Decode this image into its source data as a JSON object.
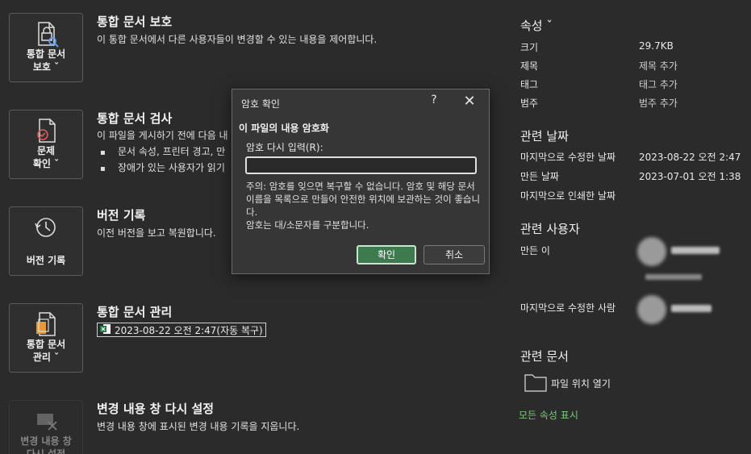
{
  "tiles": [
    {
      "label": "통합 문서\n보호 ˇ",
      "icon": "lock-document-icon"
    },
    {
      "label": "문제\n확인 ˇ",
      "icon": "inspect-document-icon"
    },
    {
      "label": "버전 기록",
      "icon": "history-icon"
    },
    {
      "label": "통합 문서\n관리 ˇ",
      "icon": "manage-workbook-icon"
    },
    {
      "label": "변경 내용 창\n다시 설정",
      "icon": "reset-changes-icon"
    }
  ],
  "sections": {
    "protect": {
      "title": "통합 문서 보호",
      "desc": "이 통합 문서에서 다른 사용자들이 변경할 수 있는 내용을 제어합니다."
    },
    "inspect": {
      "title": "통합 문서 검사",
      "desc": "이 파일을 게시하기 전에 다음 내",
      "bullets": [
        "문서 속성, 프린터 경고, 만",
        "장애가 있는 사용자가 읽기"
      ]
    },
    "versions": {
      "title": "버전 기록",
      "desc": "이전 버전을 보고 복원합니다."
    },
    "manage": {
      "title": "통합 문서 관리",
      "autosave": "2023-08-22 오전 2:47(자동 복구)"
    },
    "reset": {
      "title": "변경 내용 창 다시 설정",
      "desc": "변경 내용 창에 표시된 변경 내용 기록을 지웁니다."
    }
  },
  "properties": {
    "heading": "속성 ˇ",
    "rows": [
      {
        "key": "크기",
        "value": "29.7KB"
      },
      {
        "key": "제목",
        "value": "제목 추가"
      },
      {
        "key": "태그",
        "value": "태그 추가"
      },
      {
        "key": "범주",
        "value": "범주 추가"
      }
    ],
    "dates_heading": "관련 날짜",
    "dates": [
      {
        "key": "마지막으로 수정한 날짜",
        "value": "2023-08-22 오전 2:47"
      },
      {
        "key": "만든 날짜",
        "value": "2023-07-01 오전 1:38"
      },
      {
        "key": "마지막으로 인쇄한 날짜",
        "value": ""
      }
    ],
    "people_heading": "관련 사용자",
    "created_by_label": "만든 이",
    "modified_by_label": "마지막으로 수정한 사람",
    "docs_heading": "관련 문서",
    "open_location": "파일 위치 열기",
    "show_all": "모든 속성 표시"
  },
  "dialog": {
    "title": "암호 확인",
    "help": "?",
    "close": "✕",
    "heading": "이 파일의 내용 암호화",
    "input_label": "암호 다시 입력(R):",
    "input_value": "",
    "note": "주의: 암호를 잊으면 복구할 수 없습니다. 암호 및 해당 문서 이름을 목록으로 만들어 안전한 위치에 보관하는 것이 좋습니다.\n암호는 대/소문자를 구분합니다.",
    "ok_label": "확인",
    "cancel_label": "취소"
  },
  "colors": {
    "accent_green": "#3d7b4e",
    "link_green": "#7ec77e",
    "background": "#2b2b2b"
  }
}
